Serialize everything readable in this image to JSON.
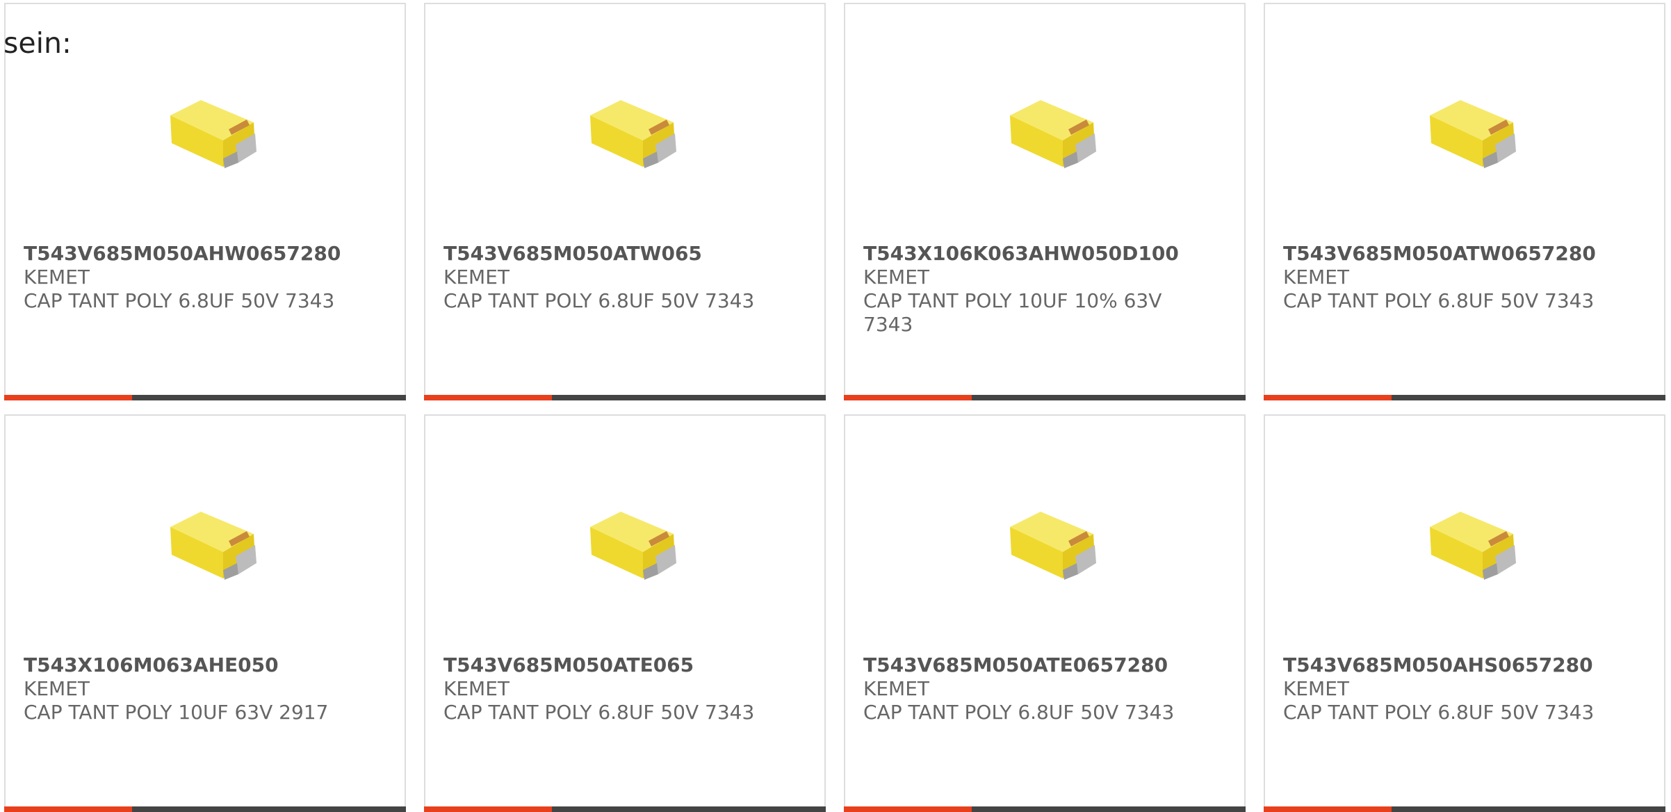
{
  "intro_text": "sein:",
  "accent_fraction": 0.318,
  "products": [
    {
      "part_number": "T543V685M050AHW0657280",
      "manufacturer": "KEMET",
      "description": "CAP TANT POLY 6.8UF 50V 7343"
    },
    {
      "part_number": "T543V685M050ATW065",
      "manufacturer": "KEMET",
      "description": "CAP TANT POLY 6.8UF 50V 7343"
    },
    {
      "part_number": "T543X106K063AHW050D100",
      "manufacturer": "KEMET",
      "description": "CAP TANT POLY 10UF 10% 63V 7343"
    },
    {
      "part_number": "T543V685M050ATW0657280",
      "manufacturer": "KEMET",
      "description": "CAP TANT POLY 6.8UF 50V 7343"
    },
    {
      "part_number": "T543X106M063AHE050",
      "manufacturer": "KEMET",
      "description": "CAP TANT POLY 10UF 63V 2917"
    },
    {
      "part_number": "T543V685M050ATE065",
      "manufacturer": "KEMET",
      "description": "CAP TANT POLY 6.8UF 50V 7343"
    },
    {
      "part_number": "T543V685M050ATE0657280",
      "manufacturer": "KEMET",
      "description": "CAP TANT POLY 6.8UF 50V 7343"
    },
    {
      "part_number": "T543V685M050AHS0657280",
      "manufacturer": "KEMET",
      "description": "CAP TANT POLY 6.8UF 50V 7343"
    }
  ],
  "colors": {
    "accent": "#e8401c",
    "bar": "#444444",
    "border": "#dddddd",
    "text": "#666666",
    "capacitor_body": "#f0dc3a"
  },
  "icons": {
    "product_image": "tantalum-capacitor-icon"
  }
}
